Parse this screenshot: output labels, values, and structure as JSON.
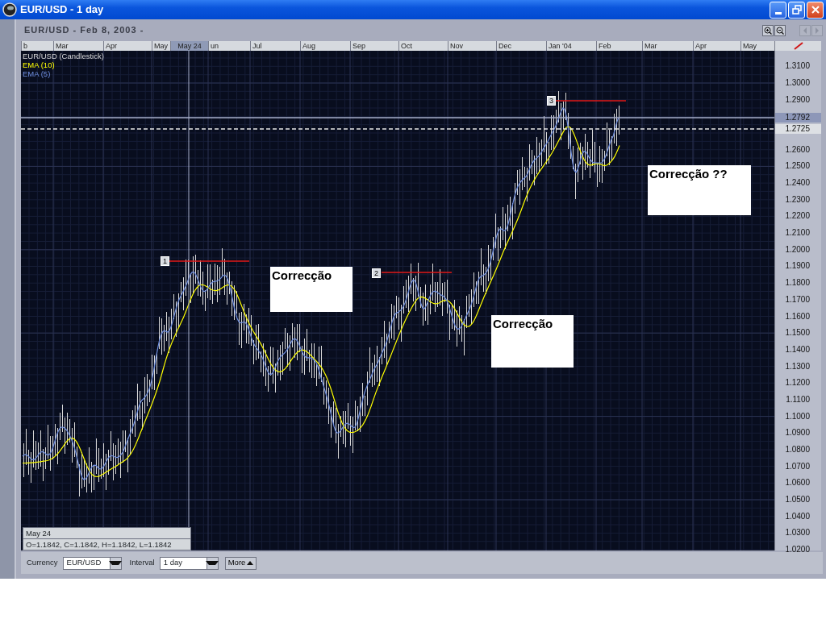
{
  "window": {
    "title": "EUR/USD - 1 day"
  },
  "chart": {
    "title": "EUR/USD - Feb 8, 2003 -",
    "x_axis": [
      {
        "label": "b",
        "cursor": false
      },
      {
        "label": "Mar",
        "cursor": false
      },
      {
        "label": "Apr",
        "cursor": false
      },
      {
        "label": "May",
        "cursor": false
      },
      {
        "label": "May 24",
        "cursor": true
      },
      {
        "label": "un",
        "cursor": false
      },
      {
        "label": "Jul",
        "cursor": false
      },
      {
        "label": "Aug",
        "cursor": false
      },
      {
        "label": "Sep",
        "cursor": false
      },
      {
        "label": "Oct",
        "cursor": false
      },
      {
        "label": "Nov",
        "cursor": false
      },
      {
        "label": "Dec",
        "cursor": false
      },
      {
        "label": "Jan '04",
        "cursor": false
      },
      {
        "label": "Feb",
        "cursor": false
      },
      {
        "label": "Mar",
        "cursor": false
      },
      {
        "label": "Apr",
        "cursor": false
      },
      {
        "label": "May",
        "cursor": false
      }
    ],
    "y_axis": [
      "1.3100",
      "1.3000",
      "1.2900",
      "1.2600",
      "1.2500",
      "1.2400",
      "1.2300",
      "1.2200",
      "1.2100",
      "1.2000",
      "1.1900",
      "1.1800",
      "1.1700",
      "1.1600",
      "1.1500",
      "1.1400",
      "1.1300",
      "1.1200",
      "1.1100",
      "1.1000",
      "1.0900",
      "1.0800",
      "1.0700",
      "1.0600",
      "1.0500",
      "1.0400",
      "1.0300",
      "1.0200"
    ],
    "price_labels": [
      {
        "text": "1.2792",
        "kind": "cursor"
      },
      {
        "text": "1.2725",
        "kind": "last"
      }
    ],
    "legend": [
      {
        "label": "EUR/USD (Candlestick)",
        "color": "#d8d8d8"
      },
      {
        "label": "EMA (10)",
        "color": "#ffff00"
      },
      {
        "label": "EMA (5)",
        "color": "#6f8fe0"
      }
    ],
    "markers": [
      {
        "label": "1"
      },
      {
        "label": "2"
      },
      {
        "label": "3"
      }
    ],
    "notes": [
      "Correcção",
      "Correcção",
      "Correcção ??"
    ],
    "readout": {
      "date": "May 24",
      "values": "O=1.1842, C=1.1842, H=1.1842, L=1.1842"
    }
  },
  "controls": {
    "currency_label": "Currency",
    "currency": "EUR/USD",
    "interval_label": "Interval",
    "interval": "1 day",
    "more_button": "More"
  }
}
